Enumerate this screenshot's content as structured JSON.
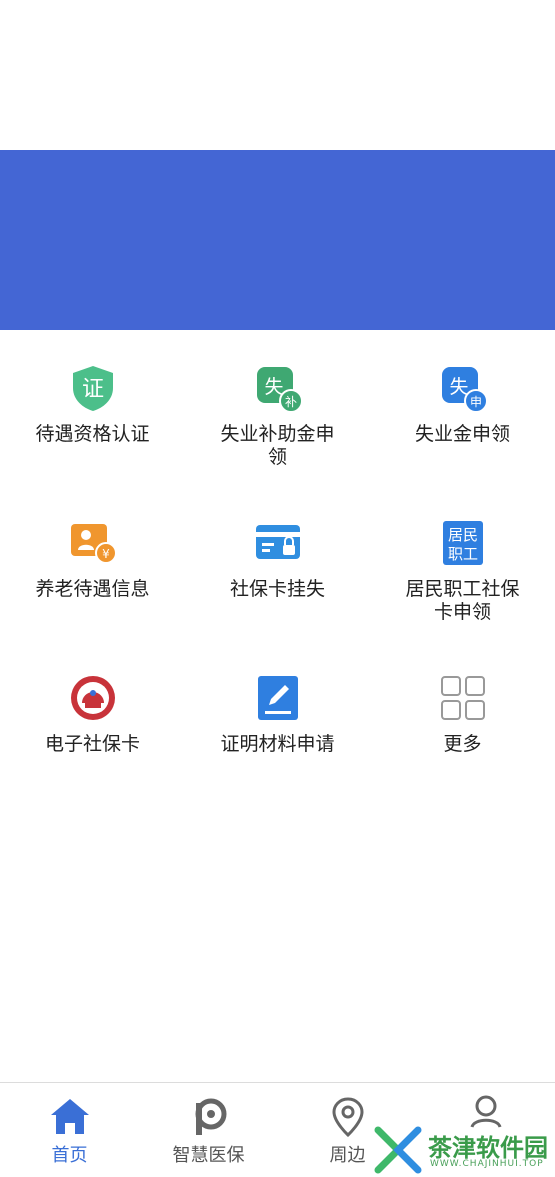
{
  "banner": {
    "color": "#4466d4"
  },
  "grid": {
    "items": [
      {
        "label": "待遇资格认证",
        "icon": "certificate-shield-icon"
      },
      {
        "label": "失业补助金申\n领",
        "icon": "unemployment-subsidy-icon"
      },
      {
        "label": "失业金申领",
        "icon": "unemployment-benefit-icon"
      },
      {
        "label": "养老待遇信息",
        "icon": "pension-info-icon"
      },
      {
        "label": "社保卡挂失",
        "icon": "card-lock-icon"
      },
      {
        "label": "居民职工社保\n卡申领",
        "icon": "resident-worker-icon"
      },
      {
        "label": "电子社保卡",
        "icon": "social-security-seal-icon"
      },
      {
        "label": "证明材料申请",
        "icon": "edit-document-icon"
      },
      {
        "label": "更多",
        "icon": "more-grid-icon"
      }
    ],
    "icon_text": {
      "cert": "证",
      "shi": "失",
      "bu": "补",
      "shen": "申",
      "yen": "¥",
      "ju_min": "居民",
      "zhi_gong": "职工"
    }
  },
  "tabbar": {
    "accent": "#3a6fd6",
    "tabs": [
      {
        "label": "首页",
        "icon": "home-icon",
        "active": true
      },
      {
        "label": "智慧医保",
        "icon": "smart-medical-insurance-icon",
        "active": false
      },
      {
        "label": "周边",
        "icon": "location-pin-icon",
        "active": false
      },
      {
        "label": "",
        "icon": "user-icon",
        "active": false
      }
    ]
  },
  "watermark": {
    "title": "茶津软件园",
    "subtitle": "WWW.CHAJINHUI.TOP"
  }
}
